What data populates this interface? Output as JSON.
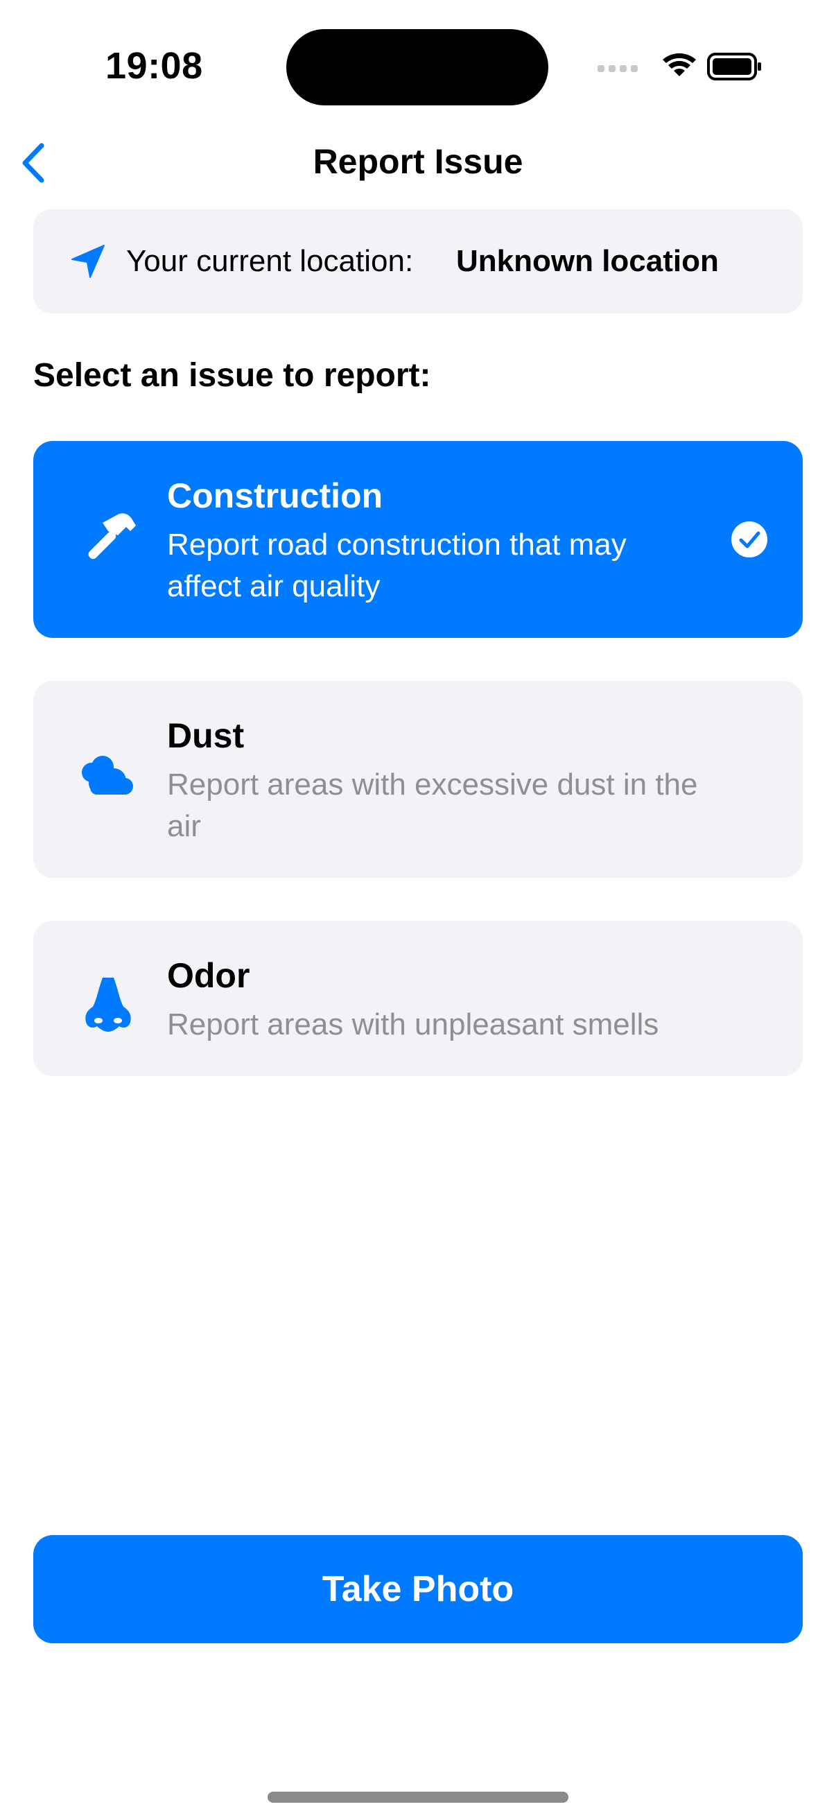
{
  "status_bar": {
    "time": "19:08",
    "icons": [
      "cellular-signal-icon",
      "wifi-icon",
      "battery-icon"
    ]
  },
  "nav": {
    "title": "Report Issue",
    "back_icon": "chevron-left-icon"
  },
  "location": {
    "icon": "location-arrow-icon",
    "label": "Your current location:",
    "value": "Unknown location"
  },
  "section_heading": "Select an issue to report:",
  "issues": [
    {
      "icon": "hammer-icon",
      "title": "Construction",
      "description": "Report road construction that may affect air quality",
      "selected": true
    },
    {
      "icon": "cloud-icon",
      "title": "Dust",
      "description": "Report areas with excessive dust in the air",
      "selected": false
    },
    {
      "icon": "nose-icon",
      "title": "Odor",
      "description": "Report areas with unpleasant smells",
      "selected": false
    }
  ],
  "actions": {
    "take_photo_label": "Take Photo"
  },
  "colors": {
    "accent": "#007aff",
    "card_background": "#f2f2f7",
    "secondary_text": "#8e8e93"
  }
}
